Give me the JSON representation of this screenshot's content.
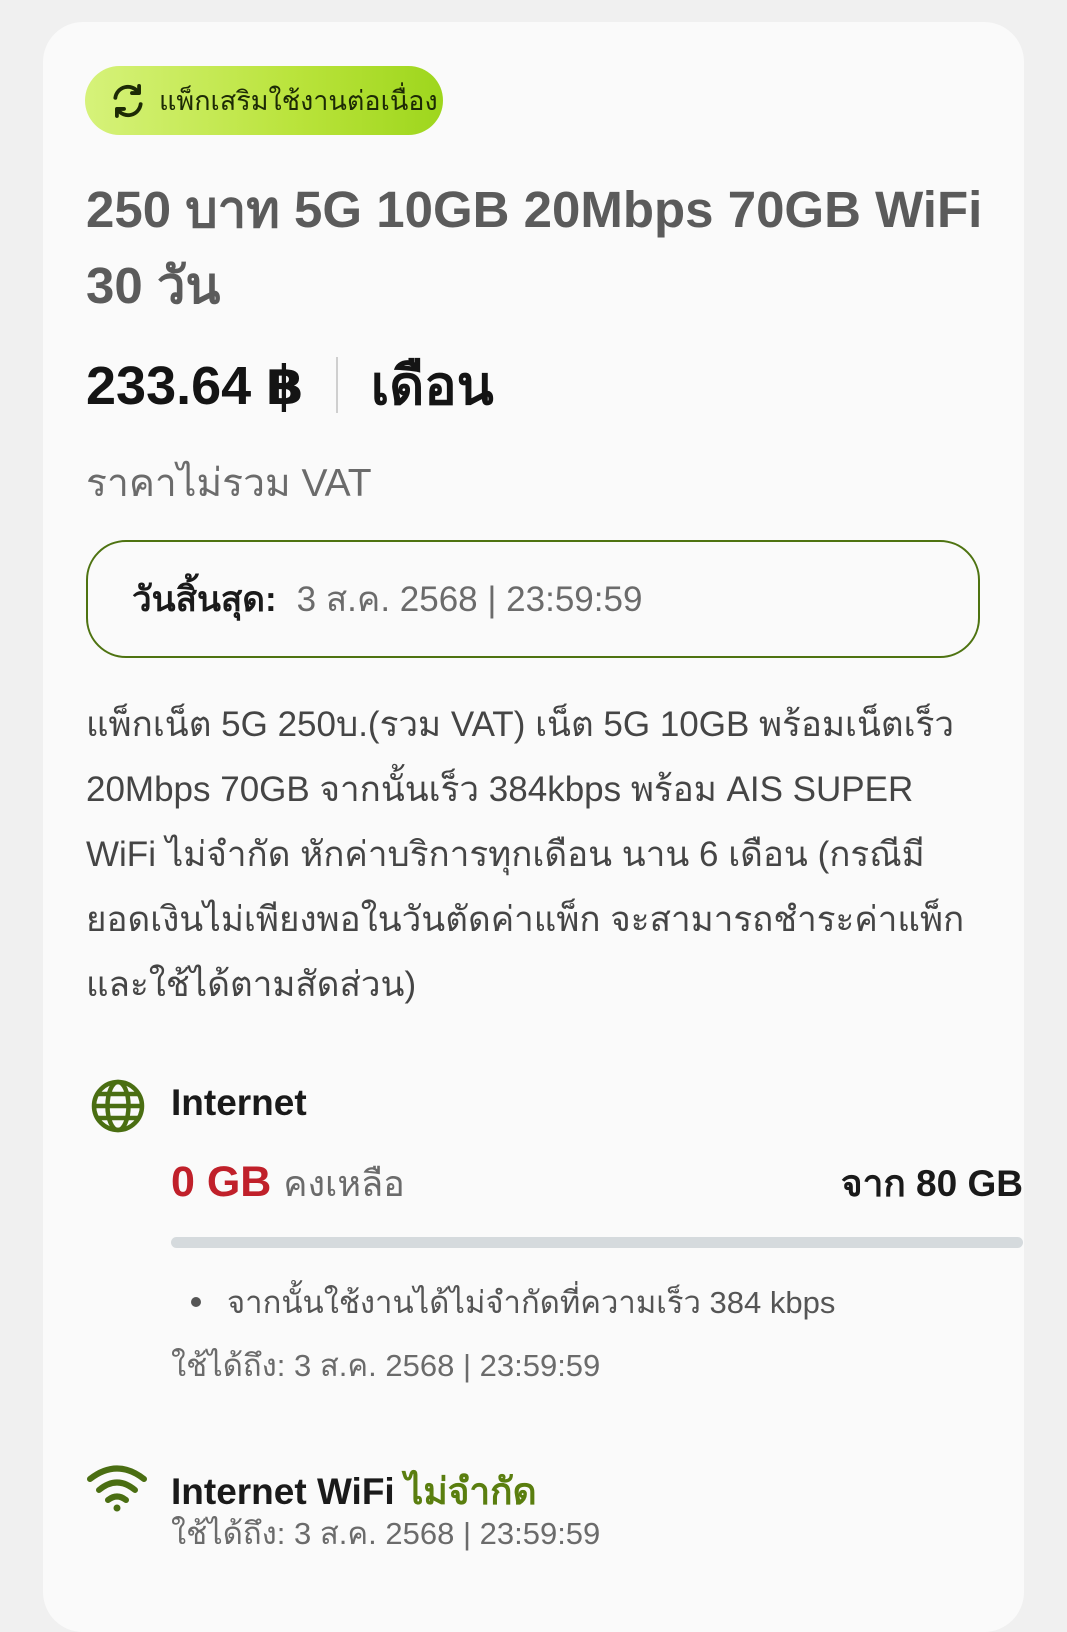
{
  "badge": {
    "icon": "refresh-icon",
    "label": "แพ็กเสริมใช้งานต่อเนื่อง",
    "color_start": "#d6f27a",
    "color_end": "#9ed61d"
  },
  "package": {
    "title": "250 บาท 5G 10GB 20Mbps 70GB WiFi 30 วัน",
    "price": "233.64 ฿",
    "period": "เดือน",
    "vat_note": "ราคาไม่รวม VAT"
  },
  "expiry": {
    "label": "วันสิ้นสุด:",
    "value": "3 ส.ค. 2568 | 23:59:59",
    "border_color": "#4e7311"
  },
  "description": "แพ็กเน็ต 5G 250บ.(รวม VAT) เน็ต 5G 10GB พร้อมเน็ตเร็ว 20Mbps 70GB จากนั้นเร็ว 384kbps พร้อม AIS SUPER WiFi ไม่จำกัด หักค่าบริการทุกเดือน นาน 6 เดือน (กรณีมียอดเงินไม่เพียงพอในวันตัดค่าแพ็ก จะสามารถชำระค่าแพ็กและใช้ได้ตามสัดส่วน)",
  "internet": {
    "icon": "globe-icon",
    "title": "Internet",
    "remaining_value": "0 GB",
    "remaining_label": "คงเหลือ",
    "total": "จาก 80 GB",
    "usage_remaining_fraction": 0,
    "note": "จากนั้นใช้งานได้ไม่จำกัดที่ความเร็ว 384 kbps",
    "valid_until": "ใช้ได้ถึง: 3 ส.ค. 2568 | 23:59:59",
    "remaining_color": "#c0202a"
  },
  "wifi": {
    "icon": "wifi-icon",
    "title": "Internet WiFi",
    "unlimited": "ไม่จำกัด",
    "valid_until": "ใช้ได้ถึง: 3 ส.ค. 2568 | 23:59:59",
    "accent_color": "#5a7e0f"
  }
}
